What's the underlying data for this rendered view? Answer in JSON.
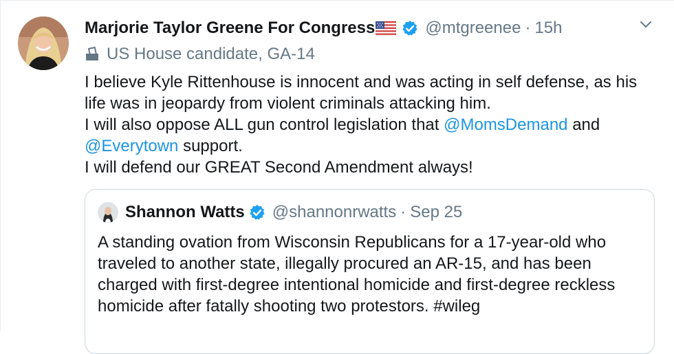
{
  "tweet": {
    "author_name": "Marjorie Taylor Greene For Congress",
    "flag_icon": "us-flag-icon",
    "handle": "@mtgreenee",
    "separator": "·",
    "time": "15h",
    "label_icon": "ballot-box-icon",
    "label": "US House candidate, GA-14",
    "lines": [
      {
        "segments": [
          {
            "text": "I believe Kyle Rittenhouse is innocent and was acting in self defense, as his life was in jeopardy from violent criminals attacking him.",
            "link": false
          }
        ]
      },
      {
        "segments": [
          {
            "text": "I will also oppose ALL gun control legislation that ",
            "link": false
          },
          {
            "text": "@MomsDemand",
            "link": true
          },
          {
            "text": " and ",
            "link": false
          },
          {
            "text": "@Everytown",
            "link": true
          },
          {
            "text": " support.",
            "link": false
          }
        ]
      },
      {
        "segments": [
          {
            "text": "I will defend our GREAT Second Amendment always!",
            "link": false
          }
        ]
      }
    ]
  },
  "quoted": {
    "author_name": "Shannon Watts",
    "handle": "@shannonrwatts",
    "separator": "·",
    "time": "Sep 25",
    "text": "A standing ovation from Wisconsin Republicans for a 17-year-old who traveled to another state, illegally procured an AR-15, and has been charged with first-degree intentional homicide and first-degree reckless homicide after fatally shooting two protestors. #wileg"
  },
  "colors": {
    "link": "#1b95e0",
    "verified": "#1da1f2",
    "secondary_text": "#657786",
    "border": "#ccd6dd"
  }
}
